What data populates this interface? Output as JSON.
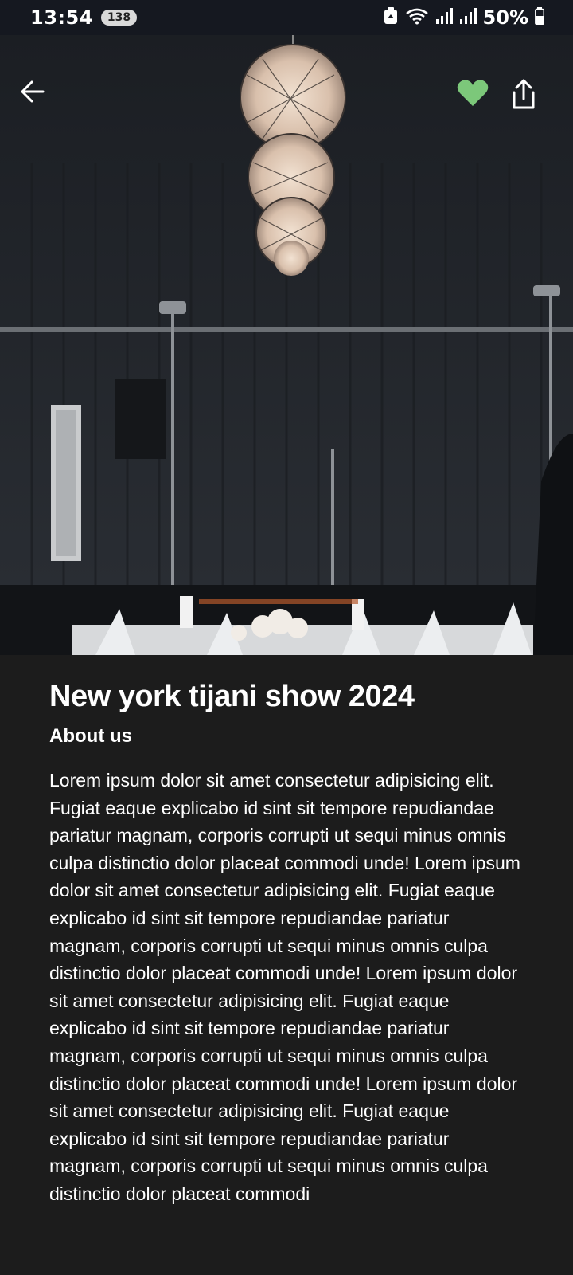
{
  "status_bar": {
    "time": "13:54",
    "notification_count": "138",
    "battery": "50%"
  },
  "hero": {
    "image_description": "event-venue-photo",
    "favorite_color": "#7cc87a",
    "is_favorite": true
  },
  "event": {
    "title": "New york tijani show 2024",
    "section_heading": "About us",
    "description": "Lorem ipsum dolor sit amet consectetur adipisicing elit. Fugiat eaque explicabo id sint sit tempore repudiandae pariatur magnam, corporis corrupti ut sequi minus omnis culpa distinctio dolor placeat commodi unde! Lorem ipsum dolor sit amet consectetur adipisicing elit. Fugiat eaque explicabo id sint sit tempore repudiandae pariatur magnam, corporis corrupti ut sequi minus omnis culpa distinctio dolor placeat commodi unde! Lorem ipsum dolor sit amet consectetur adipisicing elit. Fugiat eaque explicabo id sint sit tempore repudiandae pariatur magnam, corporis corrupti ut sequi minus omnis culpa distinctio dolor placeat commodi unde! Lorem ipsum dolor sit amet consectetur adipisicing elit. Fugiat eaque explicabo id sint sit tempore repudiandae pariatur magnam, corporis corrupti ut sequi minus omnis culpa distinctio dolor placeat commodi"
  },
  "icons": {
    "back": "arrow-left-icon",
    "favorite": "heart-icon",
    "share": "share-icon"
  }
}
